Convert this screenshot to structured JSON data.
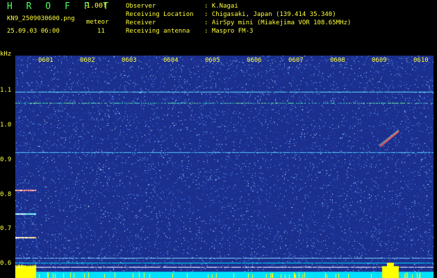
{
  "header": {
    "app_title": "H R O F F T",
    "version": "1.00f",
    "filename": "KN9_2509030600.png",
    "meteor_label": "meteor",
    "datetime": "25.09.03 06:00",
    "meteor_count": "11"
  },
  "info": [
    {
      "label": "Observer",
      "value": ": K.Nagai"
    },
    {
      "label": "Receiving Location",
      "value": ": Chigasaki, Japan (139.414 35.340)"
    },
    {
      "label": "Receiver",
      "value": ": AirSpy mini (Miakejima VOR 108.65MHz)"
    },
    {
      "label": "Receiving antenna",
      "value": ": Maspro FM-3"
    }
  ],
  "spectrogram": {
    "y_unit": "kHz",
    "y_ticks": [
      "1.1",
      "1.0",
      "0.9",
      "0.8",
      "0.7",
      "0.6"
    ],
    "x_ticks": [
      "0601",
      "0602",
      "0603",
      "0604",
      "0605",
      "0606",
      "0607",
      "0608",
      "0609",
      "0610"
    ],
    "colors": {
      "background": "#1b2f8f",
      "noise": "#5aa0ff",
      "carrier": "#40e0d0",
      "labels": "#ffff3a",
      "power_bar": "#ffff00",
      "baseline": "#00e0ff"
    }
  }
}
